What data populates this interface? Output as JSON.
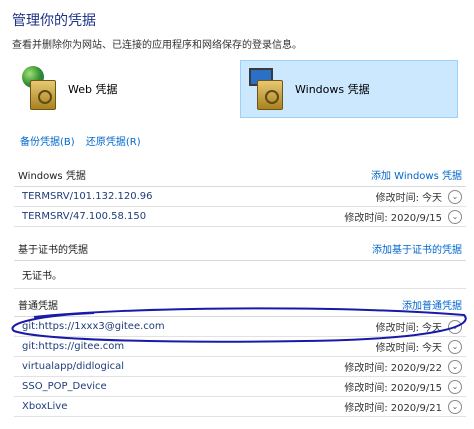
{
  "header": {
    "title": "管理你的凭据",
    "subtitle": "查看并删除你为网站、已连接的应用程序和网络保存的登录信息。"
  },
  "categories": {
    "web": "Web 凭据",
    "windows": "Windows 凭据"
  },
  "actions": {
    "backup": "备份凭据(B)",
    "restore": "还原凭据(R)"
  },
  "sections": {
    "windows": {
      "title": "Windows 凭据",
      "add": "添加 Windows 凭据",
      "items": [
        {
          "name": "TERMSRV/101.132.120.96",
          "mod_label": "修改时间:",
          "mod_value": "今天"
        },
        {
          "name": "TERMSRV/47.100.58.150",
          "mod_label": "修改时间:",
          "mod_value": "2020/9/15"
        }
      ]
    },
    "cert": {
      "title": "基于证书的凭据",
      "add": "添加基于证书的凭据",
      "empty": "无证书。"
    },
    "generic": {
      "title": "普通凭据",
      "add": "添加普通凭据",
      "items": [
        {
          "name": "git:https://1xxx3@gitee.com",
          "mod_label": "修改时间:",
          "mod_value": "今天"
        },
        {
          "name": "git:https://gitee.com",
          "mod_label": "修改时间:",
          "mod_value": "今天"
        },
        {
          "name": "virtualapp/didlogical",
          "mod_label": "修改时间:",
          "mod_value": "2020/9/22"
        },
        {
          "name": "SSO_POP_Device",
          "mod_label": "修改时间:",
          "mod_value": "2020/9/15"
        },
        {
          "name": "XboxLive",
          "mod_label": "修改时间:",
          "mod_value": "2020/9/21"
        }
      ]
    }
  },
  "icons": {
    "web": "globe-vault-icon",
    "windows": "monitor-vault-icon",
    "expand": "chevron-down-icon"
  },
  "colors": {
    "title": "#1e3287",
    "link": "#0066cc",
    "selected_bg": "#cce8ff",
    "annotation": "#1a1aa8"
  }
}
